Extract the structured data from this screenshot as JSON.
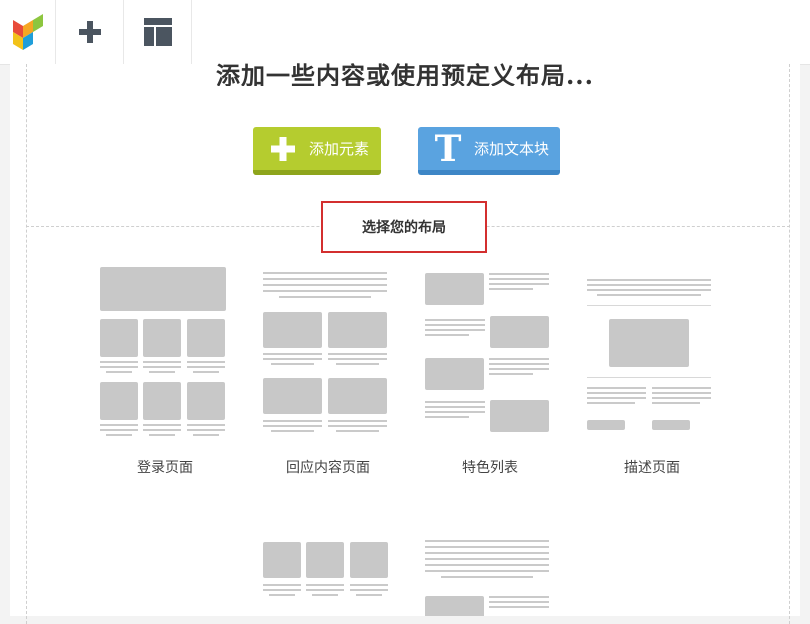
{
  "toolbar": {
    "items": [
      {
        "name": "logo-icon"
      },
      {
        "name": "plus-icon"
      },
      {
        "name": "layout-template-icon"
      }
    ]
  },
  "main": {
    "headline": "添加一些内容或使用预定义布局...",
    "add_element_label": "添加元素",
    "add_text_block_label": "添加文本块",
    "choose_layout_label": "选择您的布局"
  },
  "layouts": [
    {
      "label": "登录页面"
    },
    {
      "label": "回应内容页面"
    },
    {
      "label": "特色列表"
    },
    {
      "label": "描述页面"
    }
  ],
  "colors": {
    "add_element_bg": "#b5cc2f",
    "add_text_bg": "#5aa3e0",
    "highlight_border": "#d32f2f",
    "placeholder_gray": "#c8c8c8"
  }
}
